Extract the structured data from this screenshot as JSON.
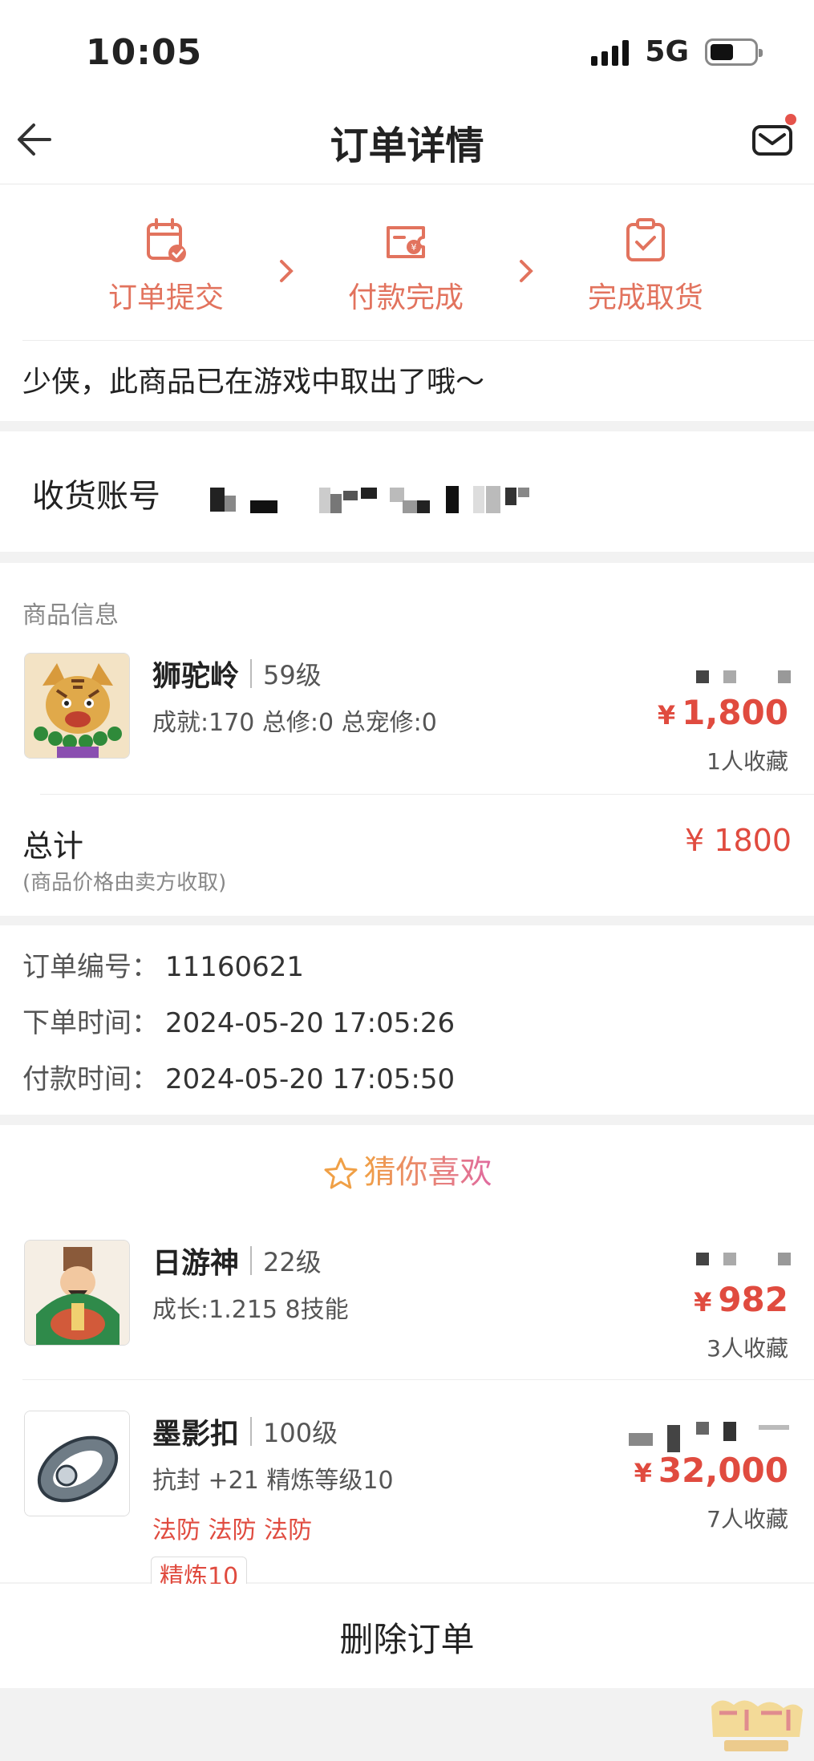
{
  "status_bar": {
    "time": "10:05",
    "network": "5G"
  },
  "nav": {
    "title": "订单详情"
  },
  "progress": {
    "steps": [
      {
        "label": "订单提交",
        "icon": "calendar-check-icon"
      },
      {
        "label": "付款完成",
        "icon": "ticket-yen-icon"
      },
      {
        "label": "完成取货",
        "icon": "clipboard-check-icon"
      }
    ]
  },
  "notice": "少侠，此商品已在游戏中取出了哦～",
  "account": {
    "label": "收货账号"
  },
  "goods": {
    "section_title": "商品信息",
    "item": {
      "name": "狮驼岭",
      "level": "59级",
      "stats": "成就:170 总修:0 总宠修:0",
      "currency": "¥",
      "price": "1,800",
      "favorites": "1人收藏"
    },
    "total_label": "总计",
    "total_note": "(商品价格由卖方收取)",
    "total_value": "¥ 1800"
  },
  "order_info": [
    {
      "key": "订单编号：",
      "value": "11160621"
    },
    {
      "key": "下单时间：",
      "value": "2024-05-20 17:05:26"
    },
    {
      "key": "付款时间：",
      "value": "2024-05-20 17:05:50"
    }
  ],
  "recommend": {
    "title": "猜你喜欢",
    "items": [
      {
        "name": "日游神",
        "level": "22级",
        "stats": "成长:1.215 8技能",
        "currency": "¥",
        "price": "982",
        "favorites": "3人收藏"
      },
      {
        "name": "墨影扣",
        "level": "100级",
        "stats": "抗封 +21 精炼等级10",
        "tags": "法防 法防 法防",
        "badge": "精炼10",
        "currency": "¥",
        "price": "32,000",
        "favorites": "7人收藏"
      }
    ]
  },
  "actions": {
    "delete": "删除订单"
  },
  "colors": {
    "accent": "#e04b3f",
    "step": "#e2735e",
    "background": "#f2f2f2"
  }
}
